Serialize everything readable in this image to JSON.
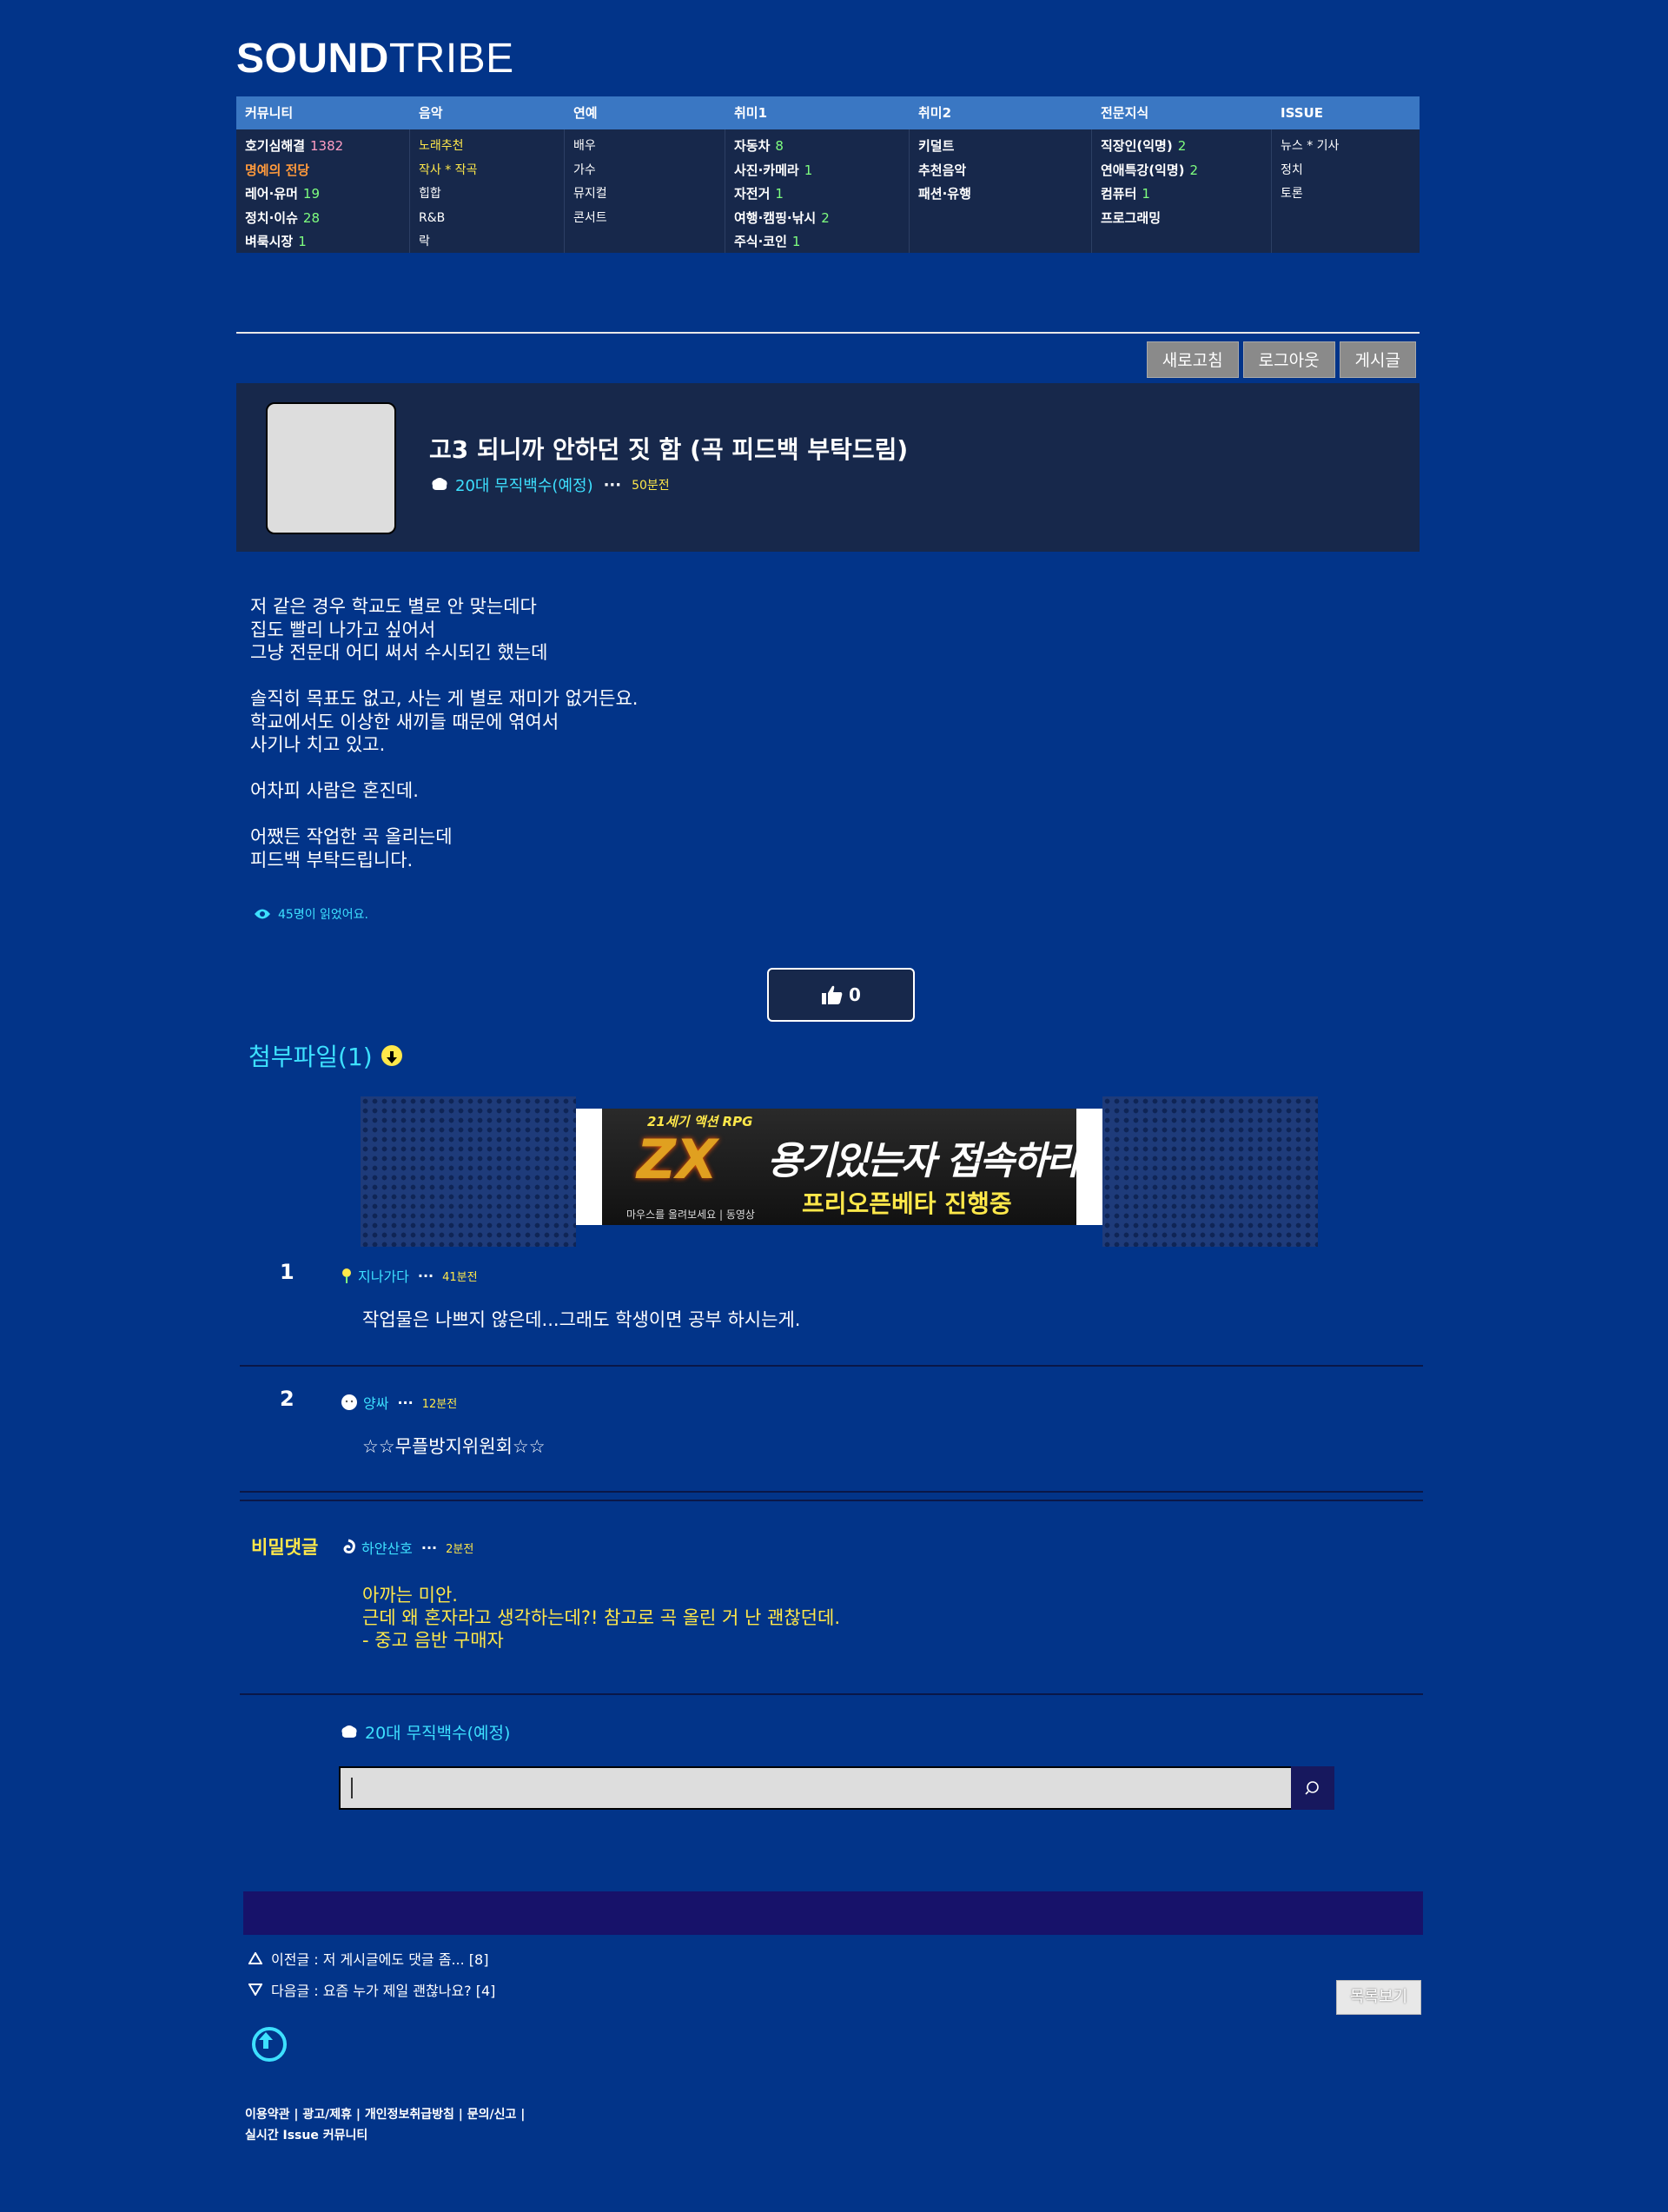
{
  "logo": {
    "bold": "SOUND",
    "thin": "TRIBE"
  },
  "menu": {
    "columns": [
      {
        "header": "커뮤니티",
        "items": [
          {
            "label": "호기심해결",
            "count": "1382",
            "label_color": "#ffffff",
            "count_color": "#ff9ec4"
          },
          {
            "label": "명예의 전당",
            "count": "",
            "label_color": "#ff9a3c"
          },
          {
            "label": "레어·유머",
            "count": "19",
            "label_color": "#ffffff",
            "count_color": "#7fff7f"
          },
          {
            "label": "정치·이슈",
            "count": "28",
            "label_color": "#ffffff",
            "count_color": "#7fff7f"
          },
          {
            "label": "벼룩시장",
            "count": "1",
            "label_color": "#ffffff",
            "count_color": "#7fff7f"
          }
        ]
      },
      {
        "header": "음악",
        "items": [
          {
            "label": "노래추천",
            "label_color": "#ffe84a"
          },
          {
            "label": "작사 * 작곡",
            "label_color": "#ffe84a"
          },
          {
            "label": "힙합"
          },
          {
            "label": "R&B"
          },
          {
            "label": "락"
          }
        ]
      },
      {
        "header": "연예",
        "items": [
          {
            "label": "배우"
          },
          {
            "label": "가수"
          },
          {
            "label": "뮤지컬"
          },
          {
            "label": "콘서트"
          }
        ]
      },
      {
        "header": "취미1",
        "items": [
          {
            "label": "자동차",
            "count": "8"
          },
          {
            "label": "사진·카메라",
            "count": "1"
          },
          {
            "label": "자전거",
            "count": "1"
          },
          {
            "label": "여행·캠핑·낚시",
            "count": "2"
          },
          {
            "label": "주식·코인",
            "count": "1"
          }
        ]
      },
      {
        "header": "취미2",
        "items": [
          {
            "label": "키덜트"
          },
          {
            "label": "추천음악"
          },
          {
            "label": "패션·유행"
          }
        ]
      },
      {
        "header": "전문지식",
        "items": [
          {
            "label": "직장인(익명)",
            "count": "2"
          },
          {
            "label": "연애특강(익명)",
            "count": "2"
          },
          {
            "label": "컴퓨터",
            "count": "1"
          },
          {
            "label": "프로그래밍"
          }
        ]
      },
      {
        "header": "ISSUE",
        "items": [
          {
            "label": "뉴스 * 기사"
          },
          {
            "label": "정치"
          },
          {
            "label": "토론"
          }
        ]
      }
    ]
  },
  "buttons": {
    "refresh": "새로고침",
    "logout": "로그아웃",
    "posts": "게시글"
  },
  "post": {
    "title": "고3 되니까 안하던 짓 함 (곡 피드백 부탁드림)",
    "author": "20대 무직백수(예정)",
    "time": "50분전",
    "body": "저 같은 경우 학교도 별로 안 맞는데다\n집도 빨리 나가고 싶어서\n그냥 전문대 어디 써서 수시되긴 했는데\n\n솔직히 목표도 없고, 사는 게 별로 재미가 없거든요.\n학교에서도 이상한 새끼들 때문에 엮여서\n사기나 치고 있고.\n\n어차피 사람은 혼진데.\n\n어쨌든 작업한 곡 올리는데\n피드백 부탁드립니다.",
    "views": "45명이 읽었어요.",
    "likes": "0"
  },
  "attachments": {
    "label": "첨부파일(1)"
  },
  "banner": {
    "top_text": "21세기 액션 RPG",
    "logo_text": "ZX",
    "headline": "용기있는자 접속하라!",
    "sub": "프리오픈베타 진행중",
    "tiny": "마우스를 올려보세요 | 동영상"
  },
  "comments": [
    {
      "num": "1",
      "author": "지나가다",
      "time": "41분전",
      "text": "작업물은 나쁘지 않은데...그래도 학생이면 공부 하시는게."
    },
    {
      "num": "2",
      "author": "양싸",
      "time": "12분전",
      "text": "☆☆무플방지위원회☆☆"
    },
    {
      "num": "비밀댓글",
      "author": "하얀산호",
      "time": "2분전",
      "text": "아까는 미안.\n근데 왜 혼자라고 생각하는데?! 참고로 곡 올린 거 난 괜찮던데.\n- 중고 음반 구매자"
    }
  ],
  "reply": {
    "user": "20대 무직백수(예정)",
    "placeholder": ""
  },
  "nav": {
    "prev": "이전글 : 저 게시글에도 댓글 좀... [8]",
    "next": "다음글 : 요즘 누가 제일 괜찮나요? [4]",
    "list_button": "목록보기"
  },
  "footer": {
    "links": "이용약관 | 광고/제휴 | 개인정보취급방침 | 문의/신고 |",
    "tagline": "실시간 Issue 커뮤니티"
  }
}
